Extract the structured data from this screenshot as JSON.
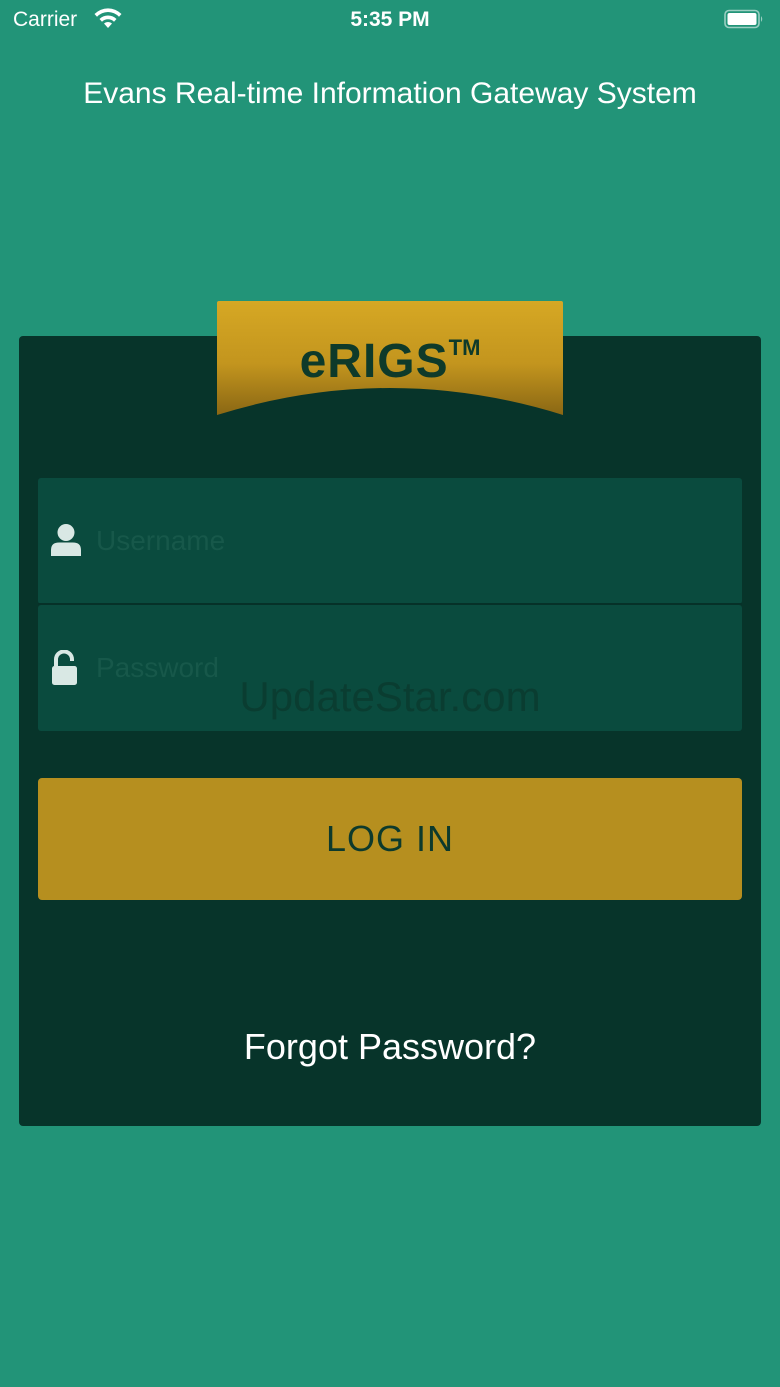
{
  "status_bar": {
    "carrier": "Carrier",
    "time": "5:35 PM",
    "wifi_icon": "wifi-icon",
    "battery_icon": "battery-icon"
  },
  "header": {
    "title": "Evans Real-time Information Gateway System"
  },
  "logo": {
    "name": "eRIGS",
    "trademark": "TM"
  },
  "login_form": {
    "username": {
      "value": "",
      "placeholder": "Username",
      "icon": "user-icon"
    },
    "password": {
      "value": "",
      "placeholder": "Password",
      "icon": "unlock-icon"
    },
    "login_label": "LOG IN",
    "forgot_label": "Forgot Password?"
  },
  "watermark": "UpdateStar.com",
  "colors": {
    "background": "#229478",
    "card": "#07342a",
    "field": "#0a4b3e",
    "gold": "#b68f1f",
    "logo_gold_top": "#d4a624",
    "logo_gold_bottom": "#8e6a16"
  }
}
